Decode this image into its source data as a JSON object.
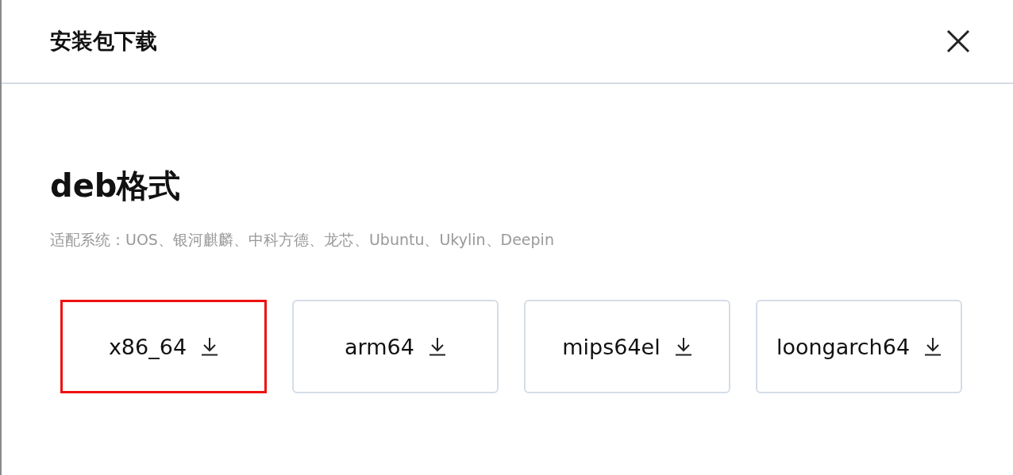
{
  "dialog": {
    "title": "安装包下载"
  },
  "section": {
    "heading": "deb格式",
    "description": "适配系统：UOS、银河麒麟、中科方德、龙芯、Ubuntu、Ukylin、Deepin"
  },
  "downloads": [
    {
      "label": "x86_64",
      "highlighted": true
    },
    {
      "label": "arm64",
      "highlighted": false
    },
    {
      "label": "mips64el",
      "highlighted": false
    },
    {
      "label": "loongarch64",
      "highlighted": false
    }
  ]
}
